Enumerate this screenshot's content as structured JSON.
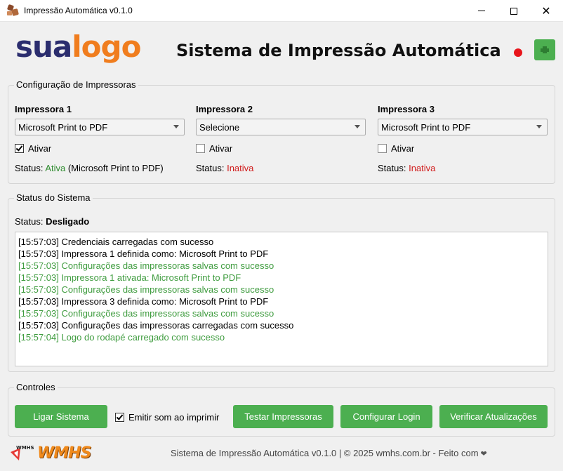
{
  "window": {
    "title": "Impressão Automática v0.1.0",
    "minimize_icon": "minimize-icon",
    "maximize_icon": "maximize-icon",
    "close_icon": "close-icon"
  },
  "header": {
    "logo_part1": "sua",
    "logo_part2": "logo",
    "title": "Sistema de Impressão Automática",
    "indicator_color": "#e8151b",
    "print_button_icon": "printer-icon"
  },
  "printers_group": {
    "legend": "Configuração de Impressoras",
    "printers": [
      {
        "name": "Impressora 1",
        "selected": "Microsoft Print to PDF",
        "activate_label": "Ativar",
        "activated": true,
        "status_label": "Status:",
        "status_value": "Ativa",
        "status_extra": " (Microsoft Print to PDF)",
        "status_color": "#2e8b2e"
      },
      {
        "name": "Impressora 2",
        "selected": "Selecione",
        "activate_label": "Ativar",
        "activated": false,
        "status_label": "Status:",
        "status_value": "Inativa",
        "status_extra": "",
        "status_color": "#d01a1a"
      },
      {
        "name": "Impressora 3",
        "selected": "Microsoft Print to PDF",
        "activate_label": "Ativar",
        "activated": false,
        "status_label": "Status:",
        "status_value": "Inativa",
        "status_extra": "",
        "status_color": "#d01a1a"
      }
    ]
  },
  "system_group": {
    "legend": "Status do Sistema",
    "status_label": "Status:",
    "status_value": "Desligado",
    "log": [
      {
        "text": "[15:57:03] Credenciais carregadas com sucesso",
        "kind": "info"
      },
      {
        "text": "[15:57:03] Impressora 1 definida como: Microsoft Print to PDF",
        "kind": "info"
      },
      {
        "text": "[15:57:03] Configurações das impressoras salvas com sucesso",
        "kind": "ok"
      },
      {
        "text": "[15:57:03] Impressora 1 ativada: Microsoft Print to PDF",
        "kind": "ok"
      },
      {
        "text": "[15:57:03] Configurações das impressoras salvas com sucesso",
        "kind": "ok"
      },
      {
        "text": "[15:57:03] Impressora 3 definida como: Microsoft Print to PDF",
        "kind": "info"
      },
      {
        "text": "[15:57:03] Configurações das impressoras salvas com sucesso",
        "kind": "ok"
      },
      {
        "text": "[15:57:03] Configurações das impressoras carregadas com sucesso",
        "kind": "info"
      },
      {
        "text": "[15:57:04] Logo do rodapé carregado com sucesso",
        "kind": "ok"
      }
    ],
    "colors": {
      "info": "#000000",
      "ok": "#3f9c3f"
    }
  },
  "controls_group": {
    "legend": "Controles",
    "start_button": "Ligar Sistema",
    "sound_label": "Emitir som ao imprimir",
    "sound_checked": true,
    "test_button": "Testar Impressoras",
    "login_button": "Configurar Login",
    "update_button": "Verificar Atualizações",
    "button_color": "#4caf50"
  },
  "footer": {
    "logo_text": "WMHS",
    "badge_text": "WMHS",
    "text": "Sistema de Impressão Automática v0.1.0 | © 2025 wmhs.com.br - Feito com",
    "heart_icon": "heart-icon"
  }
}
